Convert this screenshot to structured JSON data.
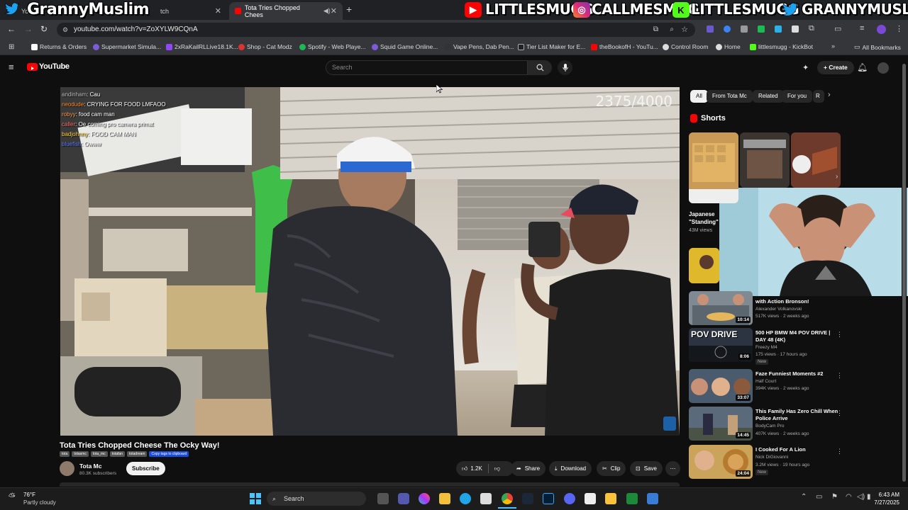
{
  "browser": {
    "tabs": [
      {
        "label": "Yo",
        "active": false
      },
      {
        "label": "tch",
        "active": false
      },
      {
        "label": "Tota Tries Chopped Chees",
        "active": true
      }
    ],
    "url": "youtube.com/watch?v=ZoXYLW9CQnA",
    "bookmarks": [
      "Returns & Orders",
      "Supermarket Simula...",
      "2xRaKailRLLive18.1K...",
      "Shop - Cat Modz",
      "Spotify - Web Playe...",
      "Squid Game Online...",
      "Vape Pens, Dab Pen...",
      "Tier List Maker for E...",
      "theBookofH - YouTu...",
      "Control Room",
      "Home",
      "littlesmugg - KickBot"
    ],
    "all_bookmarks": "All Bookmarks"
  },
  "overlay": {
    "left_name": "GrannyMuslim",
    "socials": [
      "LITTLESMUGG",
      "CALLMESMUG",
      "LITTLESMUGG",
      "GRANNYMUSLIM"
    ],
    "viewer_count": "2375/4000",
    "chat": [
      {
        "user": "andinham",
        "msg": "Cau"
      },
      {
        "user": "neodude",
        "msg": "CRYING FOR FOOD LMFAOO"
      },
      {
        "user": "robyy",
        "msg": "food cam man"
      },
      {
        "user": "caller",
        "msg": "Oe coming pro camera primat"
      },
      {
        "user": "badjohnny",
        "msg": "FOOD CAM MAN"
      },
      {
        "user": "bluefish",
        "msg": "Owww"
      }
    ]
  },
  "youtube": {
    "logo": "YouTube",
    "search_placeholder": "Search",
    "create_label": "Create",
    "video_title": "Tota Tries Chopped Cheese The Ocky Way!",
    "tags": [
      "tota",
      "totasmc",
      "tota_mc",
      "totafan",
      "totadream"
    ],
    "copy_tags": "Copy tags to clipboard",
    "channel": {
      "name": "Tota Mc",
      "subs": "80.3K subscribers"
    },
    "subscribe_label": "Subscribe",
    "actions": {
      "likes": "1.2K",
      "share": "Share",
      "download": "Download",
      "clip": "Clip",
      "save": "Save"
    },
    "chips": [
      "All",
      "From Tota Mc",
      "Related",
      "For you",
      "R"
    ],
    "shorts_label": "Shorts",
    "short_cards": [
      {
        "title": "Japanese \"Standing\"",
        "views": "43M views"
      }
    ],
    "sidebar": [
      {
        "title": "with Action Bronson!",
        "channel": "Alexander Volkanovski",
        "meta": "517K views · 2 weeks ago",
        "duration": "10:14",
        "new": ""
      },
      {
        "title": "500 HP BMW M4 POV DRIVE | DAY 48 (4K)",
        "channel": "Freezy M4",
        "meta": "175 views · 17 hours ago",
        "duration": "8:06",
        "new": "New"
      },
      {
        "title": "Faze Funniest Moments #2",
        "channel": "Half Court",
        "meta": "394K views · 2 weeks ago",
        "duration": "33:07",
        "new": ""
      },
      {
        "title": "This Family Has Zero Chill When Police Arrive",
        "channel": "BodyCam Pro",
        "meta": "407K views · 2 weeks ago",
        "duration": "14:45",
        "new": ""
      },
      {
        "title": "I Cooked For A Lion",
        "channel": "Nick DiGiovanni",
        "meta": "3.2M views · 19 hours ago",
        "duration": "24:04",
        "new": "New"
      }
    ],
    "thumb_text": "POV DRIVE"
  },
  "taskbar": {
    "weather_temp": "76°F",
    "weather_desc": "Partly cloudy",
    "search": "Search",
    "time": "6:43 AM",
    "date": "7/27/2025"
  }
}
